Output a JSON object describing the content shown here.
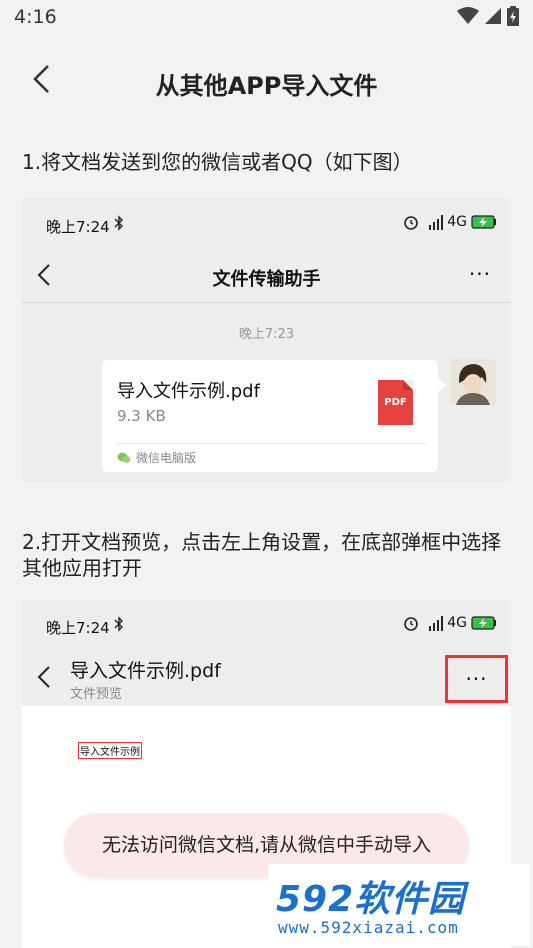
{
  "status_bar": {
    "time": "4:16"
  },
  "app_bar": {
    "title": "从其他APP导入文件"
  },
  "step1": {
    "text": "1.将文档发送到您的微信或者QQ（如下图）"
  },
  "wechat_shot": {
    "status_time": "晚上7:24",
    "network": "4G",
    "chat_title": "文件传输助手",
    "message_time": "晚上7:23",
    "file_name": "导入文件示例.pdf",
    "file_size": "9.3 KB",
    "pdf_label": "PDF",
    "source": "微信电脑版",
    "more_label": "···"
  },
  "step2": {
    "text": "2.打开文档预览，点击左上角设置，在底部弹框中选择其他应用打开"
  },
  "preview_shot": {
    "status_time": "晚上7:24",
    "network": "4G",
    "title": "导入文件示例.pdf",
    "subtitle": "文件预览",
    "more_label": "···",
    "doc_text": "导入文件示例"
  },
  "toast": {
    "text": "无法访问微信文档,请从微信中手动导入"
  },
  "watermark": {
    "logo": "592软件园",
    "url": "www.592xiazai.com"
  },
  "colors": {
    "highlight": "#ee3333",
    "pdf": "#e64340",
    "brand": "#1b70c9"
  }
}
